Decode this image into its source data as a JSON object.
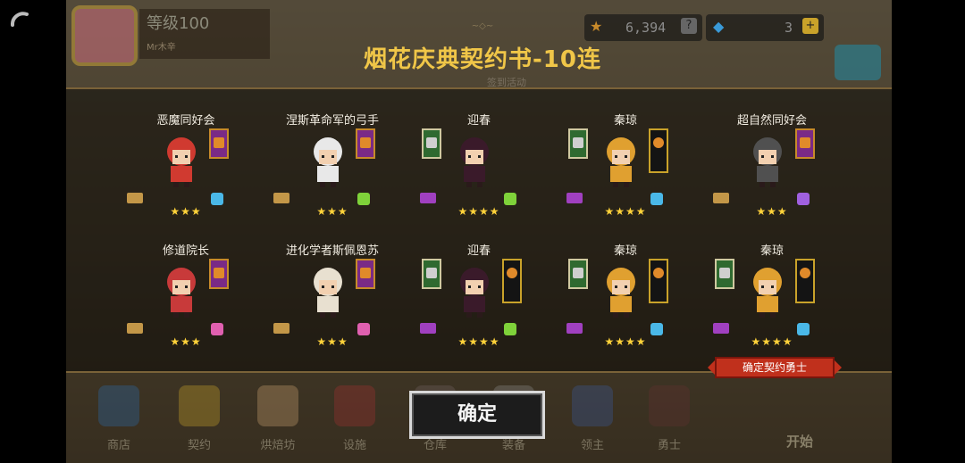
{
  "header": {
    "level": "等级100",
    "player_name": "Mr木辛",
    "gold": "6,394",
    "gold_button": "?",
    "gems": "3",
    "gems_button": "+",
    "under_title_text": "签到活动"
  },
  "dialog": {
    "title": "烟花庆典契约书-10连",
    "confirm_label": "确定",
    "confirm_tag": "确定契约勇士"
  },
  "cards": [
    {
      "name": "恶魔同好会",
      "stars": "★★★",
      "banner": "purple",
      "scroll": "gold",
      "element_color": "#4ab8e8"
    },
    {
      "name": "涅斯革命军的弓手",
      "stars": "★★★",
      "banner": "purple",
      "scroll": "gold",
      "element_color": "#7fd23a"
    },
    {
      "name": "迎春",
      "stars": "★★★★",
      "banner": "green",
      "scroll": "purple",
      "element_color": "#7fd23a"
    },
    {
      "name": "秦琼",
      "stars": "★★★★",
      "banner": "green+black",
      "scroll": "purple",
      "element_color": "#4ab8e8"
    },
    {
      "name": "超自然同好会",
      "stars": "★★★",
      "banner": "purple",
      "scroll": "gold",
      "element_color": "#a060e0"
    },
    {
      "name": "修道院长",
      "stars": "★★★",
      "banner": "purple",
      "scroll": "gold",
      "element_color": "#e060b0"
    },
    {
      "name": "进化学者斯佩恩苏",
      "stars": "★★★",
      "banner": "purple",
      "scroll": "gold",
      "element_color": "#e060b0"
    },
    {
      "name": "迎春",
      "stars": "★★★★",
      "banner": "green+black",
      "scroll": "purple",
      "element_color": "#7fd23a"
    },
    {
      "name": "秦琼",
      "stars": "★★★★",
      "banner": "green+black",
      "scroll": "purple",
      "element_color": "#4ab8e8"
    },
    {
      "name": "秦琼",
      "stars": "★★★★",
      "banner": "green+black",
      "scroll": "purple",
      "element_color": "#4ab8e8"
    }
  ],
  "dock": {
    "items": [
      "商店",
      "契约",
      "烘焙坊",
      "设施",
      "仓库",
      "装备",
      "领主",
      "勇士"
    ],
    "start": "开始"
  },
  "colors": {
    "title": "#f0c648",
    "star": "#ffd23a",
    "tag": "#c0301c"
  }
}
